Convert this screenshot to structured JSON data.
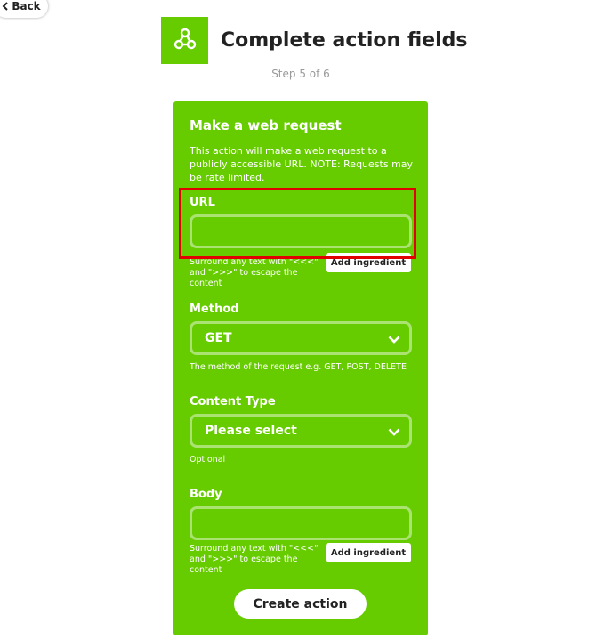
{
  "nav": {
    "back_label": "Back"
  },
  "header": {
    "title": "Complete action fields",
    "step": "Step 5 of 6",
    "logo_icon": "webhook-icon",
    "brand_color": "#66cc00"
  },
  "form": {
    "title": "Make a web request",
    "description": "This action will make a web request to a publicly accessible URL. NOTE: Requests may be rate limited.",
    "url": {
      "label": "URL",
      "value": "",
      "helper": "Surround any text with \"<<<\" and \">>>\" to escape the content",
      "add_ingredient_label": "Add ingredient"
    },
    "method": {
      "label": "Method",
      "selected": "GET",
      "helper": "The method of the request e.g. GET, POST, DELETE"
    },
    "content_type": {
      "label": "Content Type",
      "selected": "Please select",
      "helper": "Optional"
    },
    "body": {
      "label": "Body",
      "value": "",
      "helper": "Surround any text with \"<<<\" and \">>>\" to escape the content",
      "add_ingredient_label": "Add ingredient"
    },
    "submit_label": "Create action"
  },
  "highlight_color": "#e00000"
}
